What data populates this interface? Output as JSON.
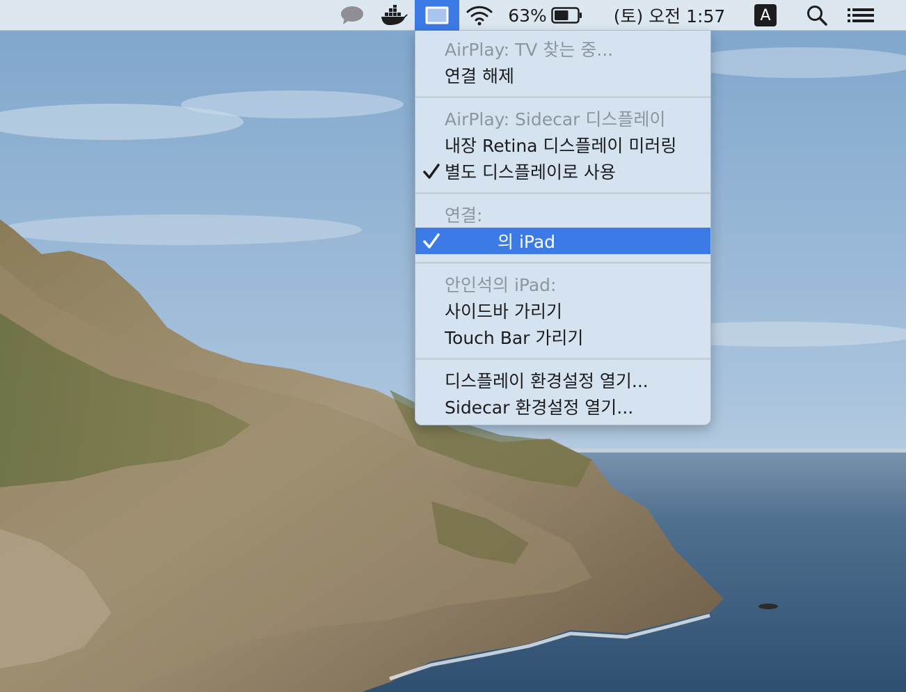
{
  "menubar": {
    "background": "#dde7f0",
    "highlight": "#3c7ae6",
    "icons": [
      "messages-bubble-icon",
      "docker-whale-icon",
      "airplay-display-icon",
      "wifi-icon",
      "battery-icon",
      "input-source-icon",
      "spotlight-search-icon",
      "notification-center-icon"
    ],
    "battery_percent": "63%",
    "battery_level": 0.63,
    "datetime": "(토) 오전 1:57",
    "input_source_letter": "A"
  },
  "airplay_menu": {
    "section_tv": {
      "header": "AirPlay: TV 찾는 중...",
      "disconnect": "연결 해제"
    },
    "section_sidecar": {
      "header": "AirPlay: Sidecar 디스플레이",
      "mirror": "내장 Retina 디스플레이 미러링",
      "separate": "별도 디스플레이로 사용",
      "separate_checked": true
    },
    "section_connect": {
      "header": "연결:",
      "device": "의 iPad",
      "device_checked": true
    },
    "section_ipad": {
      "header": "안인석의 iPad:",
      "hide_sidebar": "사이드바 가리기",
      "hide_touchbar": "Touch Bar 가리기"
    },
    "section_prefs": {
      "display_prefs": "디스플레이 환경설정 열기...",
      "sidecar_prefs": "Sidecar 환경설정 열기..."
    }
  }
}
